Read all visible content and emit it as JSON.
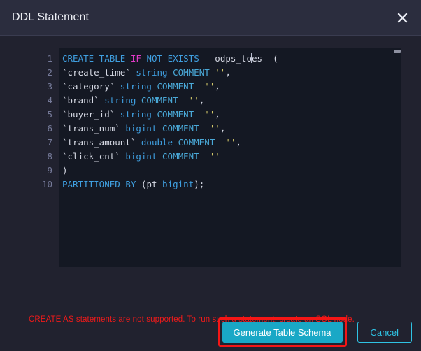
{
  "dialog": {
    "title": "DDL Statement",
    "close_icon": "close-icon"
  },
  "editor": {
    "line_numbers": [
      "1",
      "2",
      "3",
      "4",
      "5",
      "6",
      "7",
      "8",
      "9",
      "10"
    ],
    "lines": [
      "CREATE TABLE IF NOT EXISTS   odps_to|es  (",
      "`create_time` string COMMENT '',",
      "`category` string COMMENT  '',",
      "`brand` string COMMENT  '',",
      "`buyer_id` string COMMENT  '',",
      "`trans_num` bigint COMMENT  '',",
      "`trans_amount` double COMMENT  '',",
      "`click_cnt` bigint COMMENT  ''",
      ")",
      "PARTITIONED BY (pt bigint);"
    ],
    "table_name_before_caret": "odps_to",
    "table_name_after_caret": "es",
    "scrollbar": "vertical-scrollbar"
  },
  "error": {
    "text": "CREATE AS statements are not supported. To run such a statement, create an SQL node.",
    "color": "#f01a1a"
  },
  "footer": {
    "primary_label": "Generate Table Schema",
    "secondary_label": "Cancel",
    "primary_color": "#19a8c6",
    "secondary_color": "#2fc3e4",
    "highlight_color": "#f41616"
  }
}
